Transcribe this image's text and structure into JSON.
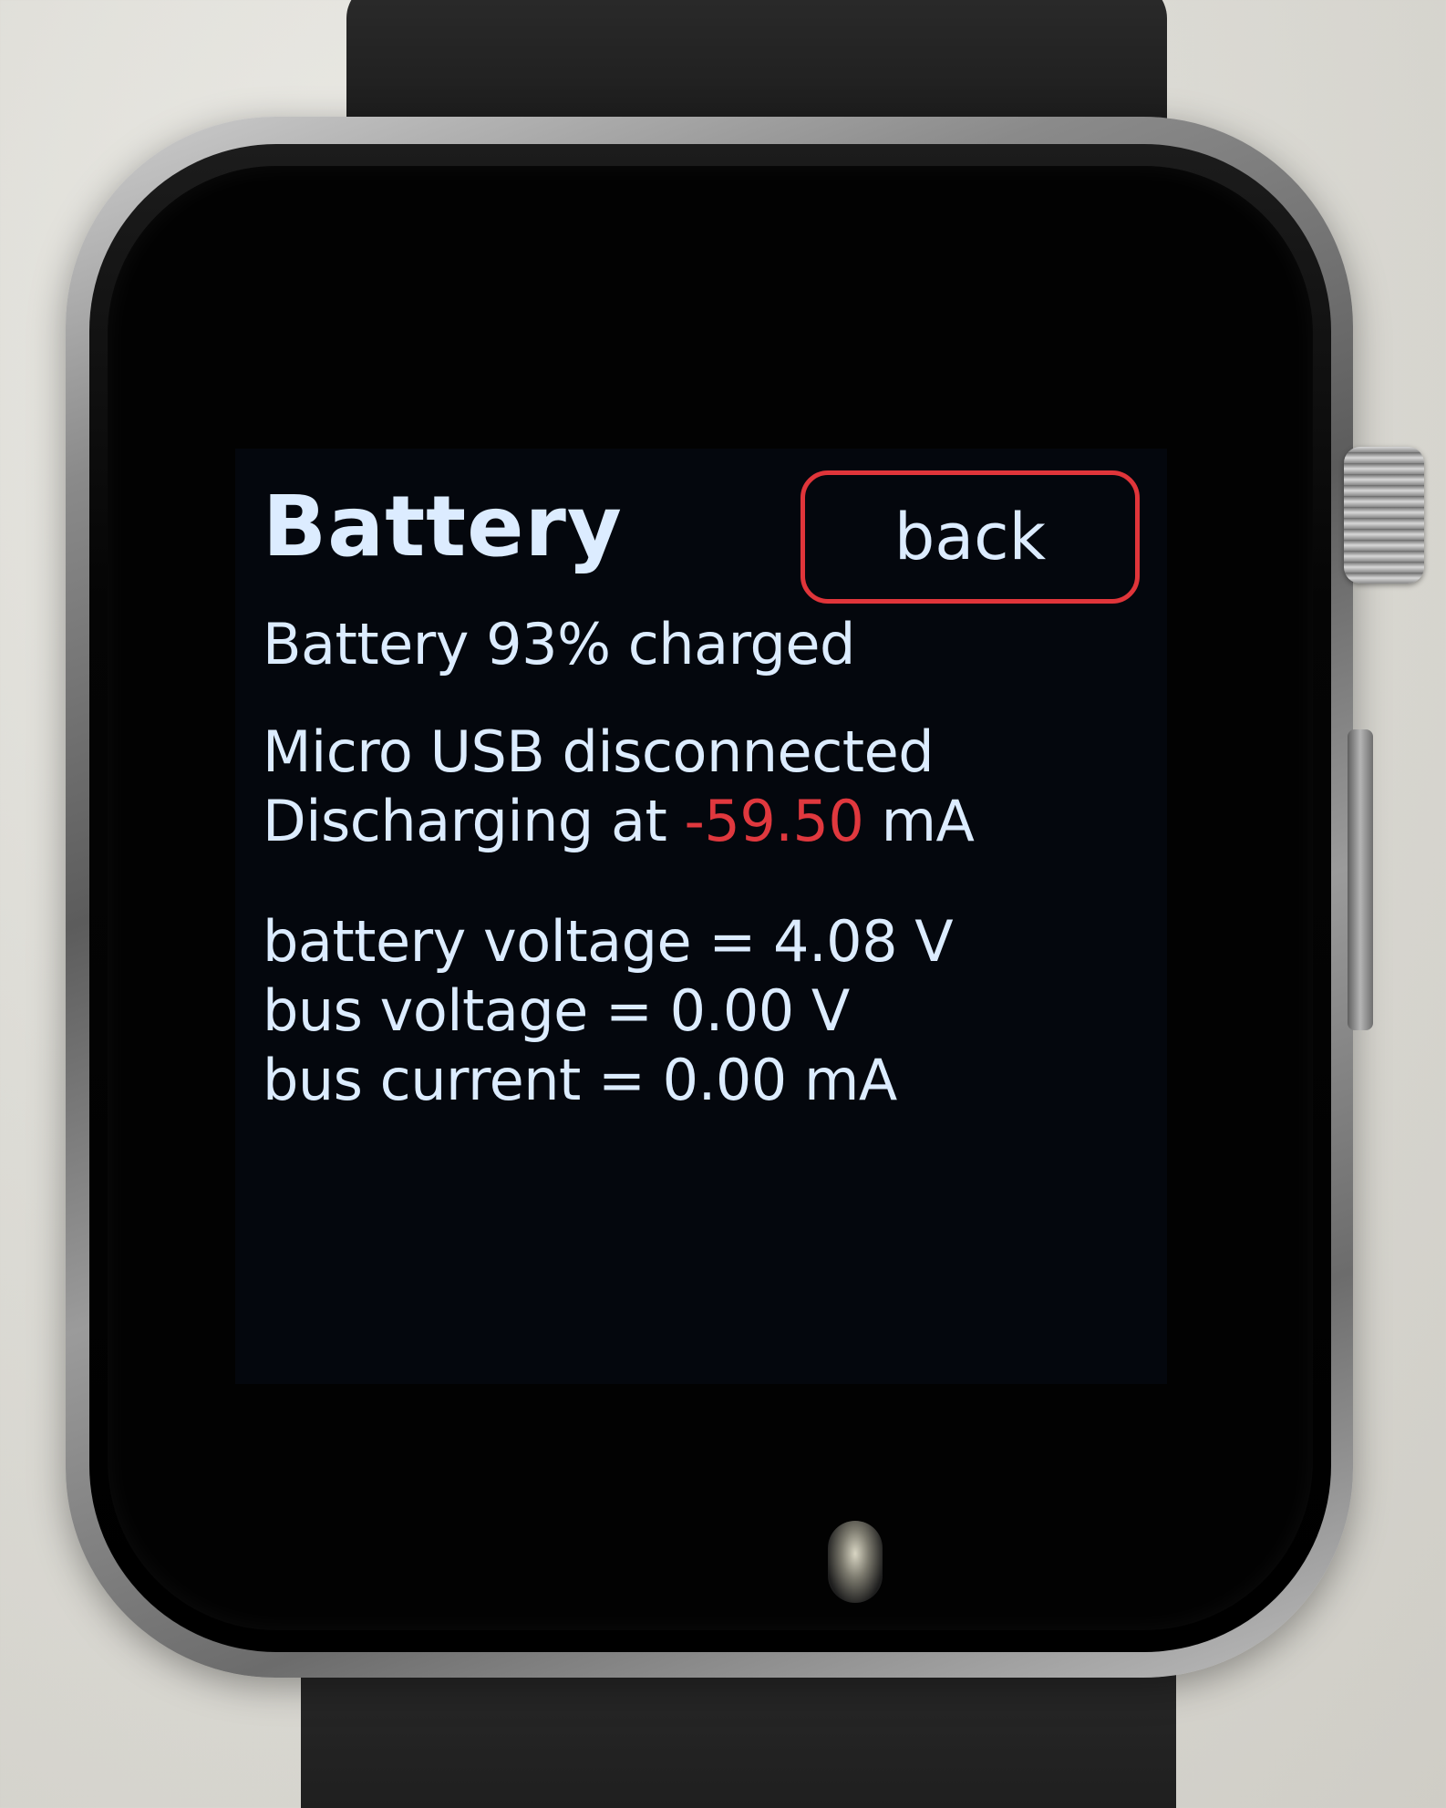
{
  "screen": {
    "title": "Battery",
    "back_label": "back",
    "charge_line": "Battery 93% charged",
    "usb_status": "Micro USB disconnected",
    "discharge_prefix": "Discharging at ",
    "discharge_value": "-59.50",
    "discharge_unit": " mA",
    "battery_voltage": "battery voltage = 4.08 V",
    "bus_voltage": "bus voltage = 0.00 V",
    "bus_current": "bus current = 0.00 mA"
  },
  "colors": {
    "text": "#dcecff",
    "accent_red": "#e0353a",
    "screen_bg": "#04070d"
  }
}
